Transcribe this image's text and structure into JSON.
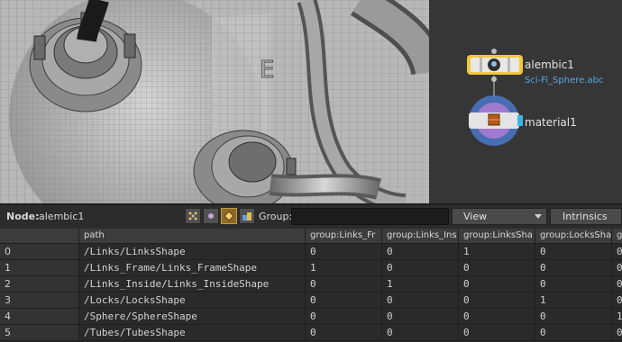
{
  "network": {
    "nodes": [
      {
        "name": "alembic1",
        "subtitle": "Sci-Fi_Sphere.abc"
      },
      {
        "name": "material1",
        "subtitle": ""
      }
    ]
  },
  "toolbar": {
    "node_label": "Node:",
    "node_name": "alembic1",
    "group_label": "Group:",
    "group_value": "",
    "view_label": "View",
    "intrinsics_label": "Intrinsics"
  },
  "spreadsheet": {
    "columns": [
      "",
      "path",
      "group:Links_Fr",
      "group:Links_Ins",
      "group:LinksSha",
      "group:LocksSha",
      "gr"
    ],
    "rows": [
      {
        "index": "0",
        "path": "/Links/LinksShape",
        "values": [
          "0",
          "0",
          "1",
          "0",
          "0"
        ]
      },
      {
        "index": "1",
        "path": "/Links_Frame/Links_FrameShape",
        "values": [
          "1",
          "0",
          "0",
          "0",
          "0"
        ]
      },
      {
        "index": "2",
        "path": "/Links_Inside/Links_InsideShape",
        "values": [
          "0",
          "1",
          "0",
          "0",
          "0"
        ]
      },
      {
        "index": "3",
        "path": "/Locks/LocksShape",
        "values": [
          "0",
          "0",
          "0",
          "1",
          "0"
        ]
      },
      {
        "index": "4",
        "path": "/Sphere/SphereShape",
        "values": [
          "0",
          "0",
          "0",
          "0",
          "1"
        ]
      },
      {
        "index": "5",
        "path": "/Tubes/TubesShape",
        "values": [
          "0",
          "0",
          "0",
          "0",
          "0"
        ]
      }
    ]
  },
  "colors": {
    "node_selected": "#f0c93a",
    "material_ring": "#4a78c8",
    "material_inner": "#a07ad0",
    "material_flag": "#3ab4e8",
    "subtitle": "#5aa8e0"
  }
}
